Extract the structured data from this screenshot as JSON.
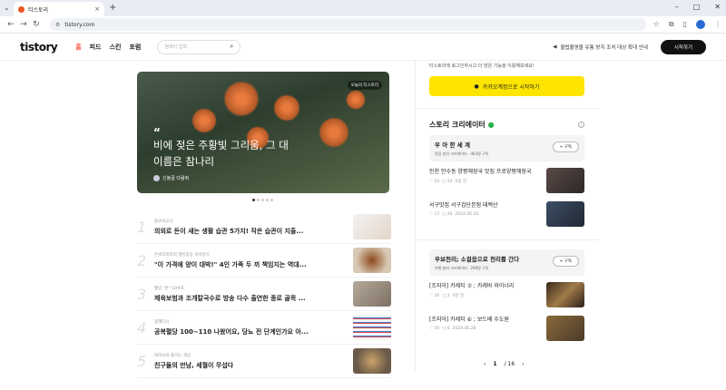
{
  "browser": {
    "tab_title": "티스토리",
    "url": "tistory.com"
  },
  "header": {
    "logo": "tistory",
    "nav": [
      "홈",
      "피드",
      "스킨",
      "포럼"
    ],
    "search_placeholder": "검색어 입력",
    "notice": "불법촬영물 유통 방지 조치 대상 확대 안내",
    "start_button": "시작하기"
  },
  "hero": {
    "badge": "오늘의 티스토리",
    "quote_mark": "“",
    "title": "비에 젖은 주황빛 그리움, 그 대 이름은 참나리",
    "author": "신봉골 다람쥐",
    "page_index": 1,
    "page_count": 5
  },
  "ranking": [
    {
      "rank": "1",
      "category": "돌보의공식",
      "title": "의외로 돈이 새는 생활 습관 5가지! 작은 습관이 지출..."
    },
    {
      "rank": "2",
      "category": "은싸리피피의 열린동동 육아일기",
      "title": "\"이 가격에 양이 대박!\" 4인 가족 두 끼 책임지는 역대..."
    },
    {
      "rank": "3",
      "category": "웰빙 \"온\" 10#포",
      "title": "제육보범과 조개칼국수로 방송 다수 출연한 종로 골목 ..."
    },
    {
      "rank": "4",
      "category": "참깨다시",
      "title": "공복혈당 100~110 나왔어요, 당뇨 전 단계인가요 아..."
    },
    {
      "rank": "5",
      "category": "대하사의 즐거는 세상",
      "title": "친구들의 만남, 세월이 무섭다"
    }
  ],
  "sidebar": {
    "login_message": "티스토리에 로그인하시고 더 많은 기능을 이용해보세요!",
    "kakao_button": "카카오계정으로 시작하기",
    "creators_heading": "스토리 크리에이터",
    "creators": [
      {
        "name": "우 아 한 세 계",
        "meta": "맛집 분야 크리에이터 · 463명 구독",
        "subscribe": "+ 구독",
        "posts": [
          {
            "title": "인천 안수동 양평해장국 맛집 프로양평해장국",
            "likes": "15",
            "comments": "22",
            "date": "4일 전"
          },
          {
            "title": "서구맛집 서구검단본점 태백산",
            "likes": "17",
            "comments": "20",
            "date": "2024.06.24"
          }
        ]
      },
      {
        "name": "우보천리; 소걸음으로 천리를 간다",
        "meta": "여행 분야 크리에이터 · 298명 구독",
        "subscribe": "+ 구독",
        "posts": [
          {
            "title": "[조지아] 카제티 ⑦ ; 카레바 와이너리",
            "likes": "26",
            "comments": "2",
            "date": "4일 전"
          },
          {
            "title": "[조지아] 카제티 ⑥ ; 보드베 수도원",
            "likes": "50",
            "comments": "6",
            "date": "2024.06.28"
          }
        ]
      }
    ],
    "pagination": {
      "current": "1",
      "total": "/ 16"
    }
  },
  "colors": {
    "accent": "#ff5544",
    "kakao": "#fee500",
    "brand_dark": "#111111"
  }
}
